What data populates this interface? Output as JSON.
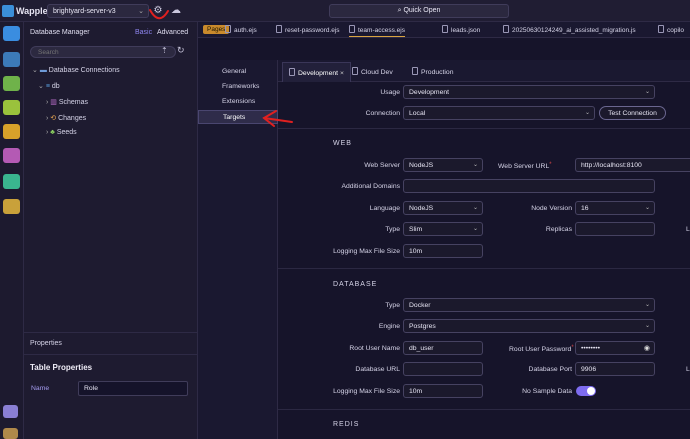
{
  "topbar": {
    "app_name": "Wappler",
    "project": "brightyard-server-v3",
    "quick_open": "Quick Open"
  },
  "left_panel": {
    "title": "Database Manager",
    "mode_basic": "Basic",
    "mode_advanced": "Advanced",
    "search_placeholder": "Search",
    "tree": {
      "root": "Database Connections",
      "db": "db",
      "children": [
        "Schemas",
        "Changes",
        "Seeds"
      ]
    }
  },
  "properties": {
    "header": "Properties",
    "title": "Table Properties",
    "name_label": "Name",
    "name_value": "Role"
  },
  "file_tabs": {
    "badge": "Pages",
    "files": [
      "auth.ejs",
      "reset-password.ejs",
      "team-access.ejs",
      "leads.json",
      "20250630124249_ai_assisted_migration.js",
      "copilo"
    ]
  },
  "settings_nav": {
    "items": [
      "General",
      "Frameworks",
      "Extensions",
      "Targets"
    ],
    "selected": "Targets"
  },
  "target_tabs": [
    "Development",
    "Cloud Dev",
    "Production"
  ],
  "form": {
    "usage_label": "Usage",
    "usage_value": "Development",
    "connection_label": "Connection",
    "connection_value": "Local",
    "test_connection": "Test Connection",
    "web": {
      "heading": "WEB",
      "web_server_label": "Web Server",
      "web_server_value": "NodeJS",
      "web_server_url_label": "Web Server URL",
      "web_server_url_value": "http://localhost:8100",
      "additional_domains_label": "Additional Domains",
      "language_label": "Language",
      "language_value": "NodeJS",
      "node_version_label": "Node Version",
      "node_version_value": "16",
      "type_label": "Type",
      "type_value": "Slim",
      "replicas_label": "Replicas",
      "replicas_value": "",
      "trailing_label": "L",
      "logging_label": "Logging Max File Size",
      "logging_value": "10m"
    },
    "database": {
      "heading": "DATABASE",
      "type_label": "Type",
      "type_value": "Docker",
      "engine_label": "Engine",
      "engine_value": "Postgres",
      "root_user_label": "Root User Name",
      "root_user_value": "db_user",
      "root_pass_label": "Root User Password",
      "root_pass_value": "••••••••",
      "db_url_label": "Database URL",
      "db_url_value": "",
      "db_port_label": "Database Port",
      "db_port_value": "9906",
      "logging_label": "Logging Max File Size",
      "logging_value": "10m",
      "no_sample_label": "No Sample Data",
      "no_sample_on": true,
      "trailing_label": "L"
    },
    "redis": {
      "heading": "REDIS"
    }
  },
  "colors": {
    "accent": "#7e6cf0",
    "badge": "#c98a2c",
    "annotation": "#e02020"
  }
}
